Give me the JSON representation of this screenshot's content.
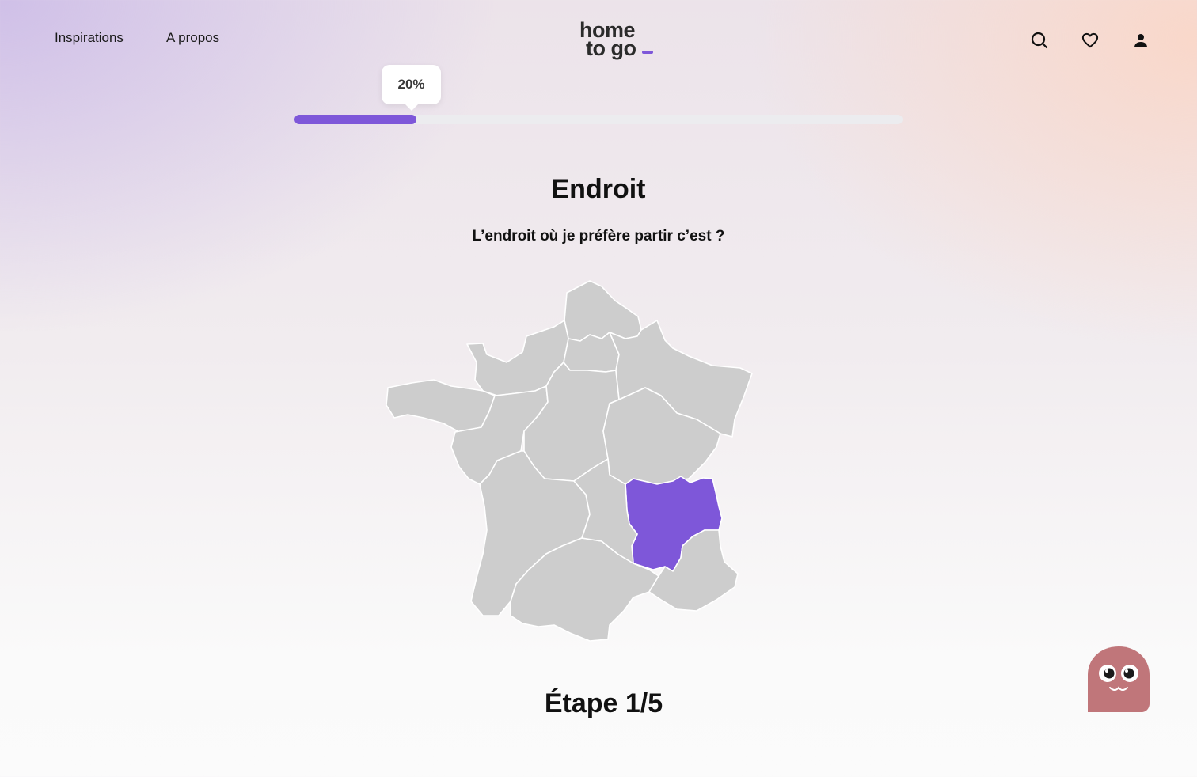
{
  "header": {
    "nav": [
      {
        "label": "Inspirations"
      },
      {
        "label": "A propos"
      }
    ],
    "logo": {
      "line1": "home",
      "line2": "to go"
    },
    "icons": [
      "search-icon",
      "heart-icon",
      "user-icon"
    ]
  },
  "progress": {
    "value": 0.2,
    "label": "20%"
  },
  "question": {
    "title": "Endroit",
    "subtitle": "L’endroit où je préfère partir c’est ?"
  },
  "map": {
    "default_color": "#cdcdcd",
    "selected_color": "#7e57d9",
    "selected_region": "auvergne-rhone-alpes"
  },
  "step": {
    "label": "Étape 1/5"
  },
  "colors": {
    "accent": "#7e57d9",
    "mascot": "#c0767a"
  }
}
